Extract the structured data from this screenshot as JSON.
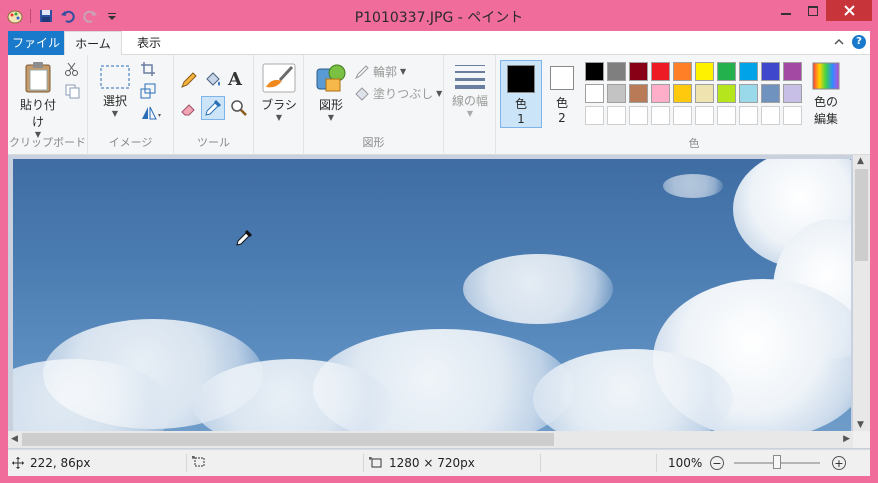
{
  "window": {
    "title": "P1010337.JPG - ペイント"
  },
  "colors": {
    "titlebar": "#f06c9b",
    "file_tab": "#1979ca",
    "close": "#c7343a",
    "selected": "#cce4f7"
  },
  "tabs": {
    "file": "ファイル",
    "home": "ホーム",
    "view": "表示"
  },
  "ribbon": {
    "clipboard": {
      "paste": "貼り付け",
      "label": "クリップボード"
    },
    "image": {
      "select": "選択",
      "label": "イメージ"
    },
    "tools": {
      "label": "ツール"
    },
    "brushes": {
      "label": "ブラシ"
    },
    "shapes": {
      "shapes": "図形",
      "outline": "輪郭",
      "fill": "塗りつぶし",
      "label": "図形"
    },
    "size": {
      "label": "線の幅"
    },
    "color1": {
      "label": "色",
      "num": "1"
    },
    "color2": {
      "label": "色",
      "num": "2"
    },
    "edit_colors": {
      "line1": "色の",
      "line2": "編集"
    },
    "colors": {
      "label": "色",
      "row1": [
        "#000000",
        "#7f7f7f",
        "#880015",
        "#ed1c24",
        "#ff7f27",
        "#fff200",
        "#22b14c",
        "#00a2e8",
        "#3f48cc",
        "#a349a4"
      ],
      "row2": [
        "#ffffff",
        "#c3c3c3",
        "#b97a57",
        "#ffaec9",
        "#ffc90e",
        "#efe4b0",
        "#b5e61d",
        "#99d9ea",
        "#7092be",
        "#c8bfe7"
      ]
    }
  },
  "status": {
    "position": "222, 86px",
    "canvas_size": "1280 × 720px",
    "zoom": "100%"
  }
}
